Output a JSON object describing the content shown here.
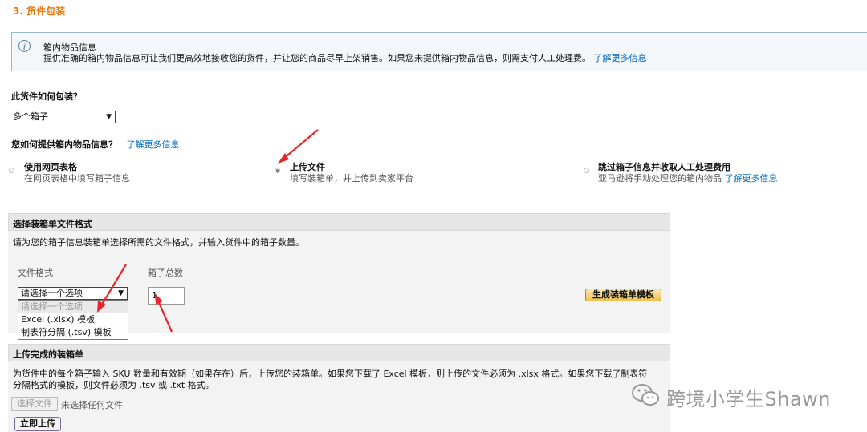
{
  "section": {
    "title": "3. 货件包装"
  },
  "info": {
    "icon": "info-icon",
    "title": "箱内物品信息",
    "text": "提供准确的箱内物品信息可让我们更高效地接收您的货件，并让您的商品尽早上架销售。如果您未提供箱内物品信息，则需支付人工处理费。",
    "link": "了解更多信息"
  },
  "packing": {
    "question": "此货件如何包装？",
    "selected": "多个箱子"
  },
  "box_info": {
    "question": "您如何提供箱内物品信息？",
    "link": "了解更多信息",
    "options": [
      {
        "title": "使用网页表格",
        "desc": "在网页表格中填写箱子信息",
        "selected": false
      },
      {
        "title": "上传文件",
        "desc": "填写装箱单，并上传到卖家平台",
        "selected": true
      },
      {
        "title": "跳过箱子信息并收取人工处理费用",
        "desc": "亚马逊将手动处理您的箱内物品",
        "link": "了解更多信息",
        "selected": false
      }
    ]
  },
  "format_panel": {
    "title": "选择装箱单文件格式",
    "desc": "请为您的箱子信息装箱单选择所需的文件格式，并输入货件中的箱子数量。",
    "col_format": "文件格式",
    "col_count": "箱子总数",
    "select_value": "请选择一个选项",
    "options": [
      "请选择一个选项",
      "Excel (.xlsx) 模板",
      "制表符分隔 (.tsv) 模板"
    ],
    "box_count": "1",
    "generate_button": "生成装箱单模板"
  },
  "upload_panel": {
    "title": "上传完成的装箱单",
    "desc_line1": "为货件中的每个箱子输入 SKU 数量和有效期（如果存在）后，上传您的装箱单。如果您下载了 Excel 模板，则上传的文件必须为 .xlsx 格式。如果您下载了制表符",
    "desc_line2": "分隔格式的模板，则文件必须为 .tsv 或 .txt 格式。",
    "choose_file": "选择文件",
    "no_file": "未选择任何文件",
    "upload_button": "立即上传"
  },
  "watermark": {
    "text": "跨境小学生Shawn",
    "icon": "wechat-icon"
  },
  "colors": {
    "section_title": "#e47911",
    "link": "#0066c0",
    "annotation_arrow": "#e8262a"
  }
}
